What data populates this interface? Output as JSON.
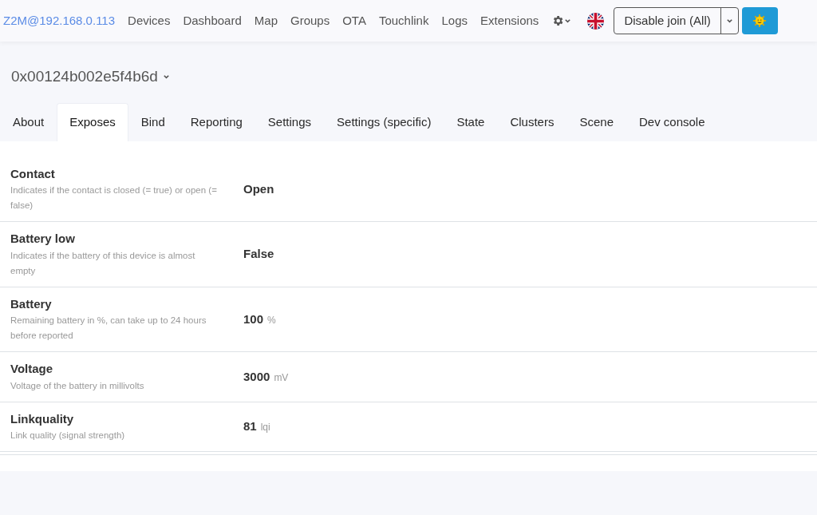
{
  "navbar": {
    "brand": "Z2M@192.168.0.113",
    "links": [
      "Devices",
      "Dashboard",
      "Map",
      "Groups",
      "OTA",
      "Touchlink",
      "Logs",
      "Extensions"
    ],
    "join_button": "Disable join (All)"
  },
  "device": {
    "title": "0x00124b002e5f4b6d"
  },
  "tabs": [
    {
      "label": "About",
      "selected": false
    },
    {
      "label": "Exposes",
      "selected": true
    },
    {
      "label": "Bind",
      "selected": false
    },
    {
      "label": "Reporting",
      "selected": false
    },
    {
      "label": "Settings",
      "selected": false
    },
    {
      "label": "Settings (specific)",
      "selected": false
    },
    {
      "label": "State",
      "selected": false
    },
    {
      "label": "Clusters",
      "selected": false
    },
    {
      "label": "Scene",
      "selected": false
    },
    {
      "label": "Dev console",
      "selected": false
    }
  ],
  "exposes": [
    {
      "name": "Contact",
      "description": "Indicates if the contact is closed (= true) or open (= false)",
      "value": "Open"
    },
    {
      "name": "Battery low",
      "description": "Indicates if the battery of this device is almost empty",
      "value": "False"
    },
    {
      "name": "Battery",
      "description": "Remaining battery in %, can take up to 24 hours before reported",
      "value": "100",
      "unit": "%"
    },
    {
      "name": "Voltage",
      "description": "Voltage of the battery in millivolts",
      "value": "3000",
      "unit": "mV"
    },
    {
      "name": "Linkquality",
      "description": "Link quality (signal strength)",
      "value": "81",
      "unit": "lqi"
    }
  ]
}
